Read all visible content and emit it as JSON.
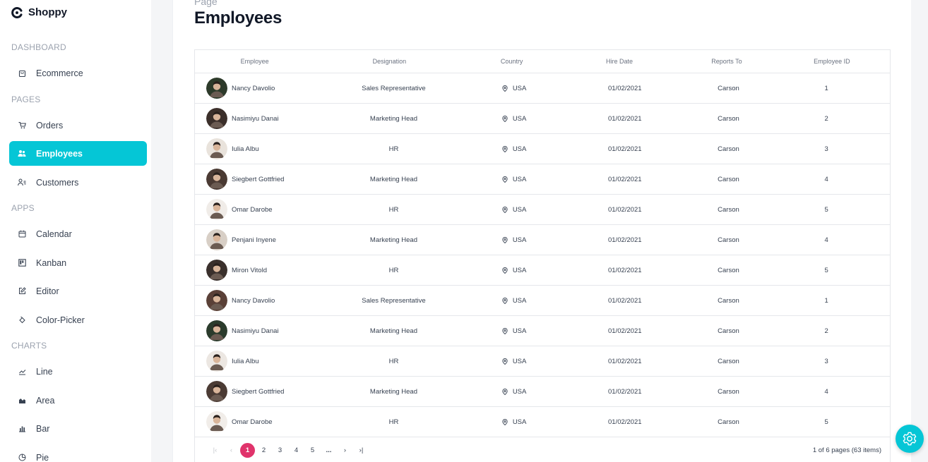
{
  "brand": {
    "name": "Shoppy"
  },
  "sidebar": {
    "sections": [
      {
        "title": "DASHBOARD",
        "items": [
          {
            "label": "Ecommerce",
            "icon": "shopping-bag-icon"
          }
        ]
      },
      {
        "title": "PAGES",
        "items": [
          {
            "label": "Orders",
            "icon": "cart-icon"
          },
          {
            "label": "Employees",
            "icon": "people-icon",
            "active": true
          },
          {
            "label": "Customers",
            "icon": "user-list-icon"
          }
        ]
      },
      {
        "title": "APPS",
        "items": [
          {
            "label": "Calendar",
            "icon": "calendar-icon"
          },
          {
            "label": "Kanban",
            "icon": "kanban-icon"
          },
          {
            "label": "Editor",
            "icon": "edit-icon"
          },
          {
            "label": "Color-Picker",
            "icon": "paint-bucket-icon"
          }
        ]
      },
      {
        "title": "CHARTS",
        "items": [
          {
            "label": "Line",
            "icon": "line-chart-icon"
          },
          {
            "label": "Area",
            "icon": "area-chart-icon"
          },
          {
            "label": "Bar",
            "icon": "bar-chart-icon"
          },
          {
            "label": "Pie",
            "icon": "pie-chart-icon"
          }
        ]
      }
    ]
  },
  "header": {
    "breadcrumb": "Page",
    "title": "Employees"
  },
  "table": {
    "columns": [
      "Employee",
      "Designation",
      "Country",
      "Hire Date",
      "Reports To",
      "Employee ID"
    ],
    "rows": [
      {
        "name": "Nancy Davolio",
        "designation": "Sales Representative",
        "country": "USA",
        "hire_date": "01/02/2021",
        "reports_to": "Carson",
        "id": "1"
      },
      {
        "name": "Nasimiyu Danai",
        "designation": "Marketing Head",
        "country": "USA",
        "hire_date": "01/02/2021",
        "reports_to": "Carson",
        "id": "2"
      },
      {
        "name": "Iulia Albu",
        "designation": "HR",
        "country": "USA",
        "hire_date": "01/02/2021",
        "reports_to": "Carson",
        "id": "3"
      },
      {
        "name": "Siegbert Gottfried",
        "designation": "Marketing Head",
        "country": "USA",
        "hire_date": "01/02/2021",
        "reports_to": "Carson",
        "id": "4"
      },
      {
        "name": "Omar Darobe",
        "designation": "HR",
        "country": "USA",
        "hire_date": "01/02/2021",
        "reports_to": "Carson",
        "id": "5"
      },
      {
        "name": "Penjani Inyene",
        "designation": "Marketing Head",
        "country": "USA",
        "hire_date": "01/02/2021",
        "reports_to": "Carson",
        "id": "4"
      },
      {
        "name": "Miron Vitold",
        "designation": "HR",
        "country": "USA",
        "hire_date": "01/02/2021",
        "reports_to": "Carson",
        "id": "5"
      },
      {
        "name": "Nancy Davolio",
        "designation": "Sales Representative",
        "country": "USA",
        "hire_date": "01/02/2021",
        "reports_to": "Carson",
        "id": "1"
      },
      {
        "name": "Nasimiyu Danai",
        "designation": "Marketing Head",
        "country": "USA",
        "hire_date": "01/02/2021",
        "reports_to": "Carson",
        "id": "2"
      },
      {
        "name": "Iulia Albu",
        "designation": "HR",
        "country": "USA",
        "hire_date": "01/02/2021",
        "reports_to": "Carson",
        "id": "3"
      },
      {
        "name": "Siegbert Gottfried",
        "designation": "Marketing Head",
        "country": "USA",
        "hire_date": "01/02/2021",
        "reports_to": "Carson",
        "id": "4"
      },
      {
        "name": "Omar Darobe",
        "designation": "HR",
        "country": "USA",
        "hire_date": "01/02/2021",
        "reports_to": "Carson",
        "id": "5"
      }
    ]
  },
  "pager": {
    "pages": [
      "1",
      "2",
      "3",
      "4",
      "5",
      "..."
    ],
    "current": "1",
    "info": "1 of 6 pages (63 items)"
  },
  "colors": {
    "accent": "#05c6d6",
    "pager_active": "#e0336b"
  }
}
